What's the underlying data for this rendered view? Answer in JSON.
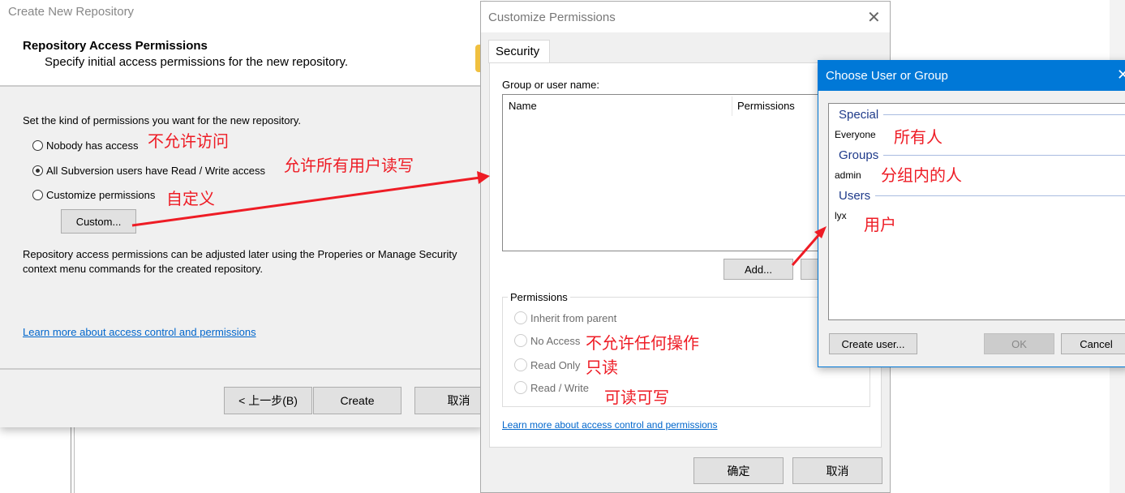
{
  "create_repo": {
    "title": "Create New Repository",
    "heading": "Repository Access Permissions",
    "subheading": "Specify initial access permissions for the new repository.",
    "prompt": "Set the kind of permissions you want for the new repository.",
    "options": [
      {
        "label": "Nobody has access",
        "selected": false,
        "note": "不允许访问"
      },
      {
        "label": "All Subversion users have Read / Write access",
        "selected": true,
        "note": "允许所有用户读写"
      },
      {
        "label": "Customize permissions",
        "selected": false,
        "note": "自定义"
      }
    ],
    "custom_button": "Custom...",
    "info": "Repository access permissions can be adjusted later using the Properies or Manage Security context menu commands for the created repository.",
    "learn_more": "Learn more about access control and permissions",
    "back_button": "< 上一步(B)",
    "create_button": "Create",
    "cancel_button": "取消"
  },
  "customize": {
    "title": "Customize Permissions",
    "tab": "Security",
    "group_label": "Group or user name:",
    "columns": [
      "Name",
      "Permissions"
    ],
    "add_button": "Add...",
    "permissions_legend": "Permissions",
    "permissions": [
      {
        "label": "Inherit from parent",
        "note": ""
      },
      {
        "label": "No Access",
        "note": "不允许任何操作"
      },
      {
        "label": "Read Only",
        "note": "只读"
      },
      {
        "label": "Read / Write",
        "note": "可读可写"
      }
    ],
    "learn_more": "Learn more about access control and permissions",
    "ok_button": "确定",
    "cancel_button": "取消"
  },
  "choose": {
    "title": "Choose User or Group",
    "accent": "#0078d7",
    "sections": [
      {
        "header": "Special",
        "item": "Everyone",
        "note": "所有人"
      },
      {
        "header": "Groups",
        "item": "admin",
        "note": "分组内的人"
      },
      {
        "header": "Users",
        "item": "lyx",
        "note": "用户"
      }
    ],
    "create_user_button": "Create user...",
    "ok_button": "OK",
    "cancel_button": "Cancel"
  }
}
